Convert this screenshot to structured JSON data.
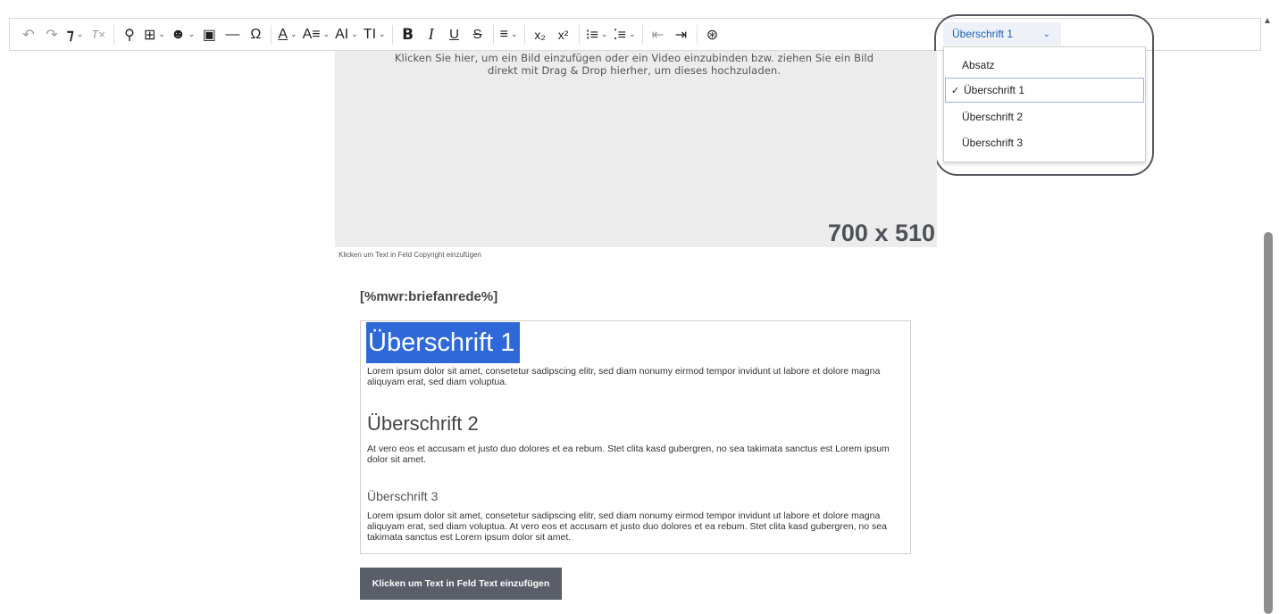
{
  "toolbar": {
    "undo_glyph": "↶",
    "redo_glyph": "↷",
    "format_painter_glyph": "⁊",
    "clear_format_glyph": "T×",
    "link_glyph": "⚲",
    "table_glyph": "⊞",
    "emoji_glyph": "☻",
    "image_glyph": "▣",
    "hr_glyph": "—",
    "omega_glyph": "Ω",
    "font_color_glyph": "A",
    "font_size_glyph": "A≡",
    "line_height_glyph": "AI",
    "text_transform_glyph": "TI",
    "bold_glyph": "B",
    "italic_glyph": "I",
    "underline_glyph": "U",
    "strike_glyph": "S",
    "align_glyph": "≡",
    "subscript_glyph": "x₂",
    "superscript_glyph": "x²",
    "ordered_list_glyph": "⁝≡",
    "bullet_list_glyph": "⁚≡",
    "outdent_glyph": "⇤",
    "indent_glyph": "⇥",
    "accessibility_glyph": "⊛",
    "caret": "⌄"
  },
  "heading_select": {
    "value": "Überschrift 1"
  },
  "dropdown": {
    "items": [
      {
        "label": "Absatz",
        "selected": false
      },
      {
        "label": "Überschrift 1",
        "selected": true
      },
      {
        "label": "Überschrift 2",
        "selected": false
      },
      {
        "label": "Überschrift 3",
        "selected": false
      }
    ],
    "check_glyph": "✓"
  },
  "image": {
    "hint": "Klicken Sie hier, um ein Bild einzufügen oder ein Video einzubinden bzw. ziehen Sie ein Bild direkt mit Drag & Drop hierher, um dieses hochzuladen.",
    "size_label": "700 x 510",
    "copyright_hint": "Klicken um Text in Feld Copyright einzufügen"
  },
  "letter": {
    "salutation": "[%mwr:briefanrede%]",
    "heading1": "Überschrift 1",
    "para1": "Lorem ipsum dolor sit amet, consetetur sadipscing elitr, sed diam nonumy eirmod tempor invidunt ut labore et dolore magna aliquyam erat, sed diam voluptua.",
    "heading2": "Überschrift 2",
    "para2": "At vero eos et accusam et justo duo dolores et ea rebum. Stet clita kasd gubergren, no sea takimata sanctus est Lorem ipsum dolor sit amet.",
    "heading3": "Überschrift 3",
    "para3": "Lorem ipsum dolor sit amet, consetetur sadipscing elitr, sed diam nonumy eirmod tempor invidunt ut labore et dolore magna aliquyam erat, sed diam voluptua. At vero eos et accusam et justo duo dolores et ea rebum. Stet clita kasd gubergren, no sea takimata sanctus est Lorem ipsum dolor sit amet."
  },
  "text_button": {
    "label": "Klicken um Text in Feld Text einzufügen"
  },
  "colors": {
    "accent": "#2f68d8",
    "select_text": "#1b5fb8",
    "button_bg": "#5a5e69",
    "placeholder_bg": "#ececec"
  }
}
